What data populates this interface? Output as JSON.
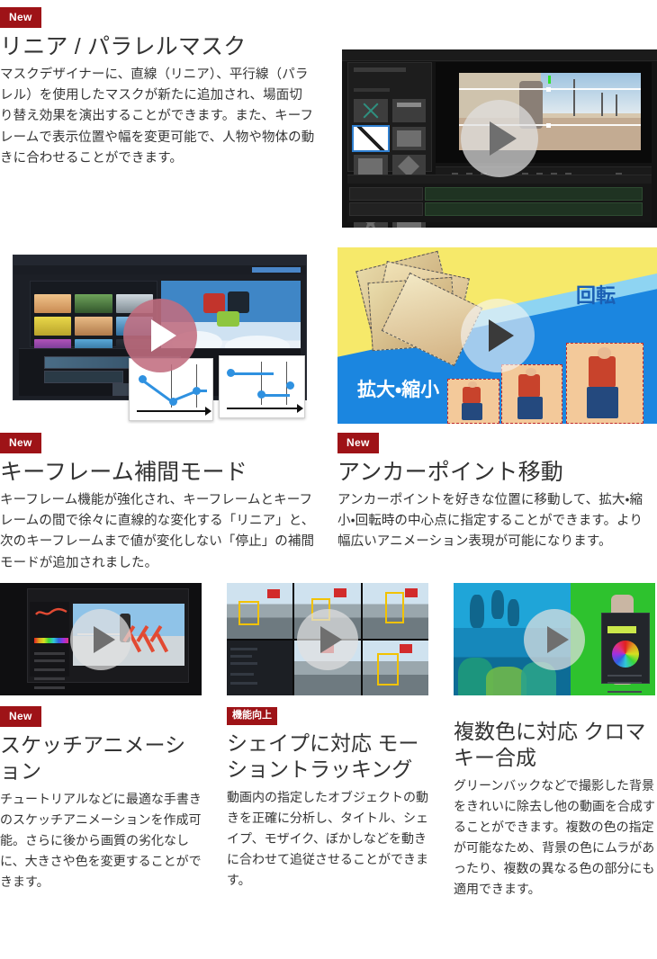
{
  "sections": [
    {
      "badge": "New",
      "badge_type": "new",
      "title": "リニア / パラレルマスク",
      "body": "マスクデザイナーに、直線（リニア）、平行線（パラレル）を使用したマスクが新たに追加され、場面切り替え効果を演出することができます。また、キーフレームで表示位置や幅を変更可能で、人物や物体の動きに合わせることができます。",
      "media_name": "mask-designer-video-thumbnail"
    },
    {
      "badge": "New",
      "badge_type": "new",
      "title": "キーフレーム補間モード",
      "body": "キーフレーム機能が強化され、キーフレームとキーフレームの間で徐々に直線的な変化する「リニア」と、次のキーフレームまで値が変化しない「停止」の補間モードが追加されました。",
      "media_name": "keyframe-interpolation-video-thumbnail"
    },
    {
      "badge": "New",
      "badge_type": "new",
      "title": "アンカーポイント移動",
      "body": "アンカーポイントを好きな位置に移動して、拡大・縮小・回転時の中心点に指定することができます。より幅広いアニメーション表現が可能になります。",
      "media_name": "anchor-point-video-thumbnail"
    },
    {
      "badge": "New",
      "badge_type": "new",
      "title": "スケッチアニメーション",
      "body": "チュートリアルなどに最適な手書きのスケッチアニメーションを作成可能。さらに後から画質の劣化なしに、大きさや色を変更することができます。",
      "media_name": "sketch-animation-video-thumbnail"
    },
    {
      "badge": "機能向上",
      "badge_type": "upgrade",
      "title": "シェイプに対応 モーショントラッキング",
      "body": "動画内の指定したオブジェクトの動きを正確に分析し、タイトル、シェイプ、モザイク、ぼかしなどを動きに合わせて追従させることができます。",
      "media_name": "motion-tracking-video-thumbnail"
    },
    {
      "badge": "",
      "badge_type": "none",
      "title": "複数色に対応 クロマキー合成",
      "body": "グリーンバックなどで撮影した背景をきれいに除去し他の動画を合成することができます。複数の色の指定が可能なため、背景の色にムラがあったり、複数の異なる色の部分にも適用できます。",
      "media_name": "chroma-key-video-thumbnail"
    }
  ],
  "graphics": {
    "anchor_rotate_label": "回転",
    "anchor_scale_label": "拡大・縮小"
  },
  "colors": {
    "badge_bg": "#9e1317",
    "badge_text": "#ffffff",
    "heading": "#333333",
    "body": "#333333",
    "page_bg": "#ffffff",
    "play_grey": "#e1e1e1",
    "play_rose": "#c16d7f",
    "accent_blue": "#2f91e0",
    "chroma_green": "#2ec22e"
  },
  "icons": {
    "play": "play-triangle-icon"
  }
}
